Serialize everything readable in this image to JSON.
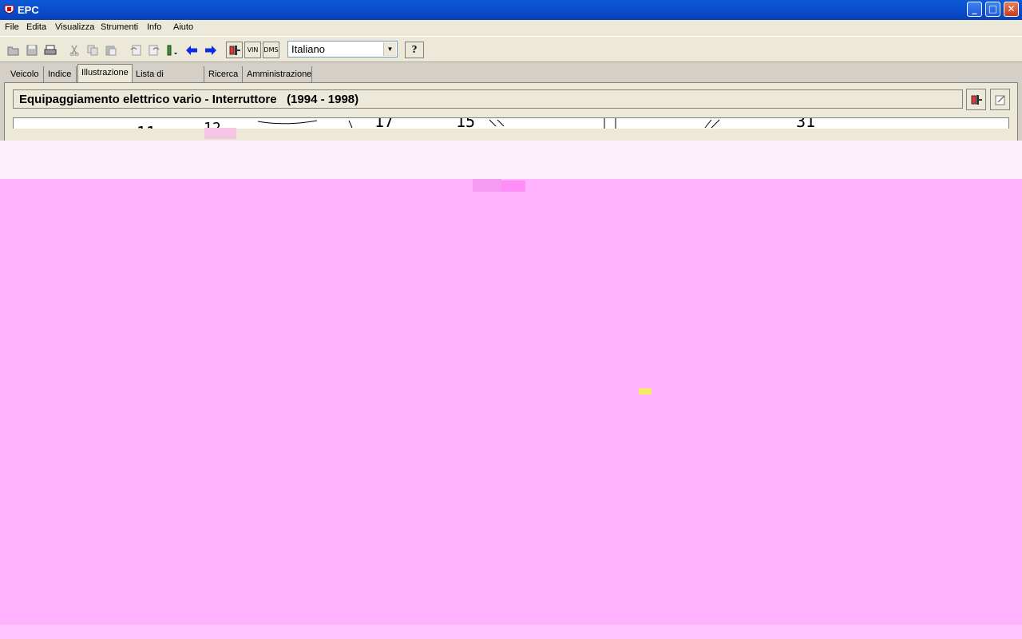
{
  "window": {
    "title": "EPC",
    "min": "_",
    "max": "□",
    "close": "✕"
  },
  "menu": [
    "File",
    "Edita",
    "Visualizza",
    "Strumenti",
    "Info",
    "Aiuto"
  ],
  "toolbar": {
    "vin_label": "VIN",
    "dms_label": "DMS",
    "language": "Italiano",
    "help": "?"
  },
  "tabs": [
    "Veicolo",
    "Indice",
    "Illustrazione",
    "Lista di selezione",
    "Ricerca",
    "Amministrazione"
  ],
  "active_tab": "Illustrazione",
  "header": {
    "title": "Equipaggiamento elettrico vario - Interruttore",
    "years": "(1994 - 1998)"
  },
  "drawing": {
    "callouts": [
      "11",
      "12",
      "17",
      "15",
      "31"
    ]
  },
  "colors": {
    "titlebar": "#0a5ad6",
    "overlay": "#ffb3fe",
    "overlay_light": "#fdf0fb"
  }
}
